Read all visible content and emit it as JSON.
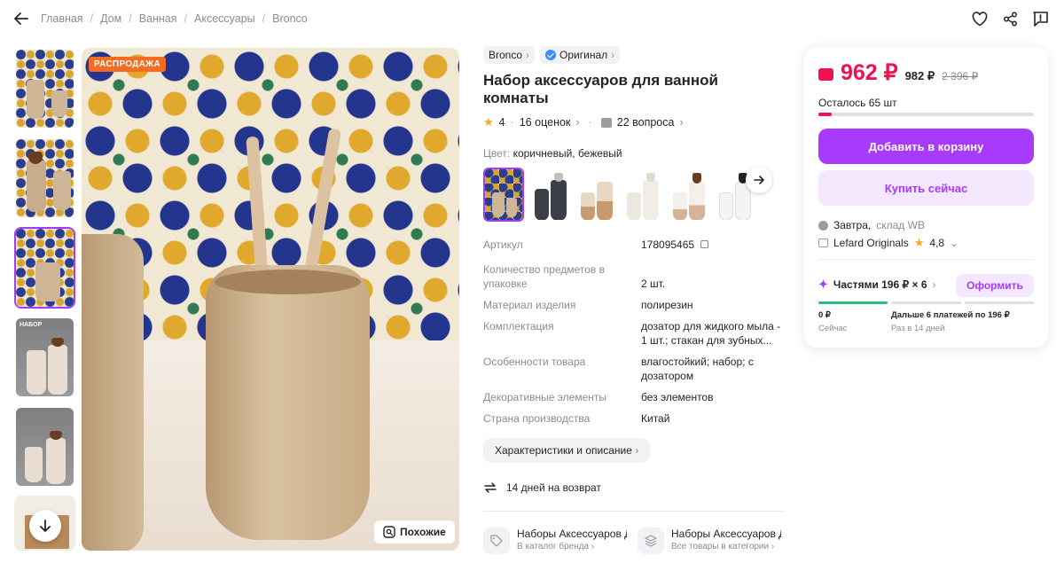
{
  "breadcrumb": [
    "Главная",
    "Дом",
    "Ванная",
    "Аксессуары",
    "Bronco"
  ],
  "icons": {
    "back": "arrow-left-icon",
    "favorite": "heart-icon",
    "share": "share-icon",
    "report": "report-icon"
  },
  "gallery": {
    "sale_badge": "РАСПРОДАЖА",
    "similar_label": "Похожие",
    "active_thumb": 3
  },
  "product": {
    "brand": "Bronco",
    "original_label": "Оригинал",
    "title": "Набор аксессуаров для ванной комнаты",
    "rating": "4",
    "reviews": "16 оценок",
    "questions": "22 вопроса",
    "color_label": "Цвет:",
    "color_value": "коричневый, бежевый"
  },
  "specs": [
    {
      "k": "Артикул",
      "v": "178095465"
    },
    {
      "k": "Количество предметов в упаковке",
      "v": "2 шт."
    },
    {
      "k": "Материал изделия",
      "v": "полирезин"
    },
    {
      "k": "Комплектация",
      "v": "дозатор для жидкого мыла - 1 шт.; стакан для зубных..."
    },
    {
      "k": "Особенности товара",
      "v": "влагостойкий; набор; с дозатором"
    },
    {
      "k": "Декоративные элементы",
      "v": "без элементов"
    },
    {
      "k": "Страна производства",
      "v": "Китай"
    }
  ],
  "details_button": "Характеристики и описание",
  "return_text": "14 дней на возврат",
  "brand_links": [
    {
      "title": "Наборы Аксессуаров Д",
      "sub": "В каталог бренда"
    },
    {
      "title": "Наборы Аксессуаров Д",
      "sub": "Все товары в категории"
    }
  ],
  "buybox": {
    "price": "962 ₽",
    "price_alt": "982 ₽",
    "old_price": "2 396 ₽",
    "stock_text": "Осталось 65 шт",
    "stock_fraction": 0.06,
    "add_to_cart": "Добавить в корзину",
    "buy_now": "Купить сейчас",
    "delivery_day": "Завтра,",
    "delivery_place": "склад WB",
    "seller": "Lefard Originals",
    "seller_rating": "4,8",
    "installments": "Частями 196 ₽ × 6",
    "order_button": "Оформить",
    "pay_now_amount": "0 ₽",
    "pay_now_label": "Сейчас",
    "pay_later_amount": "Дальше 6 платежей по 196 ₽",
    "pay_later_label": "Раз в 14 дней"
  },
  "colors": {
    "accent": "#a73afd",
    "price": "#f1114d",
    "sale": "#f36c21",
    "progress": "#2dba7f"
  }
}
